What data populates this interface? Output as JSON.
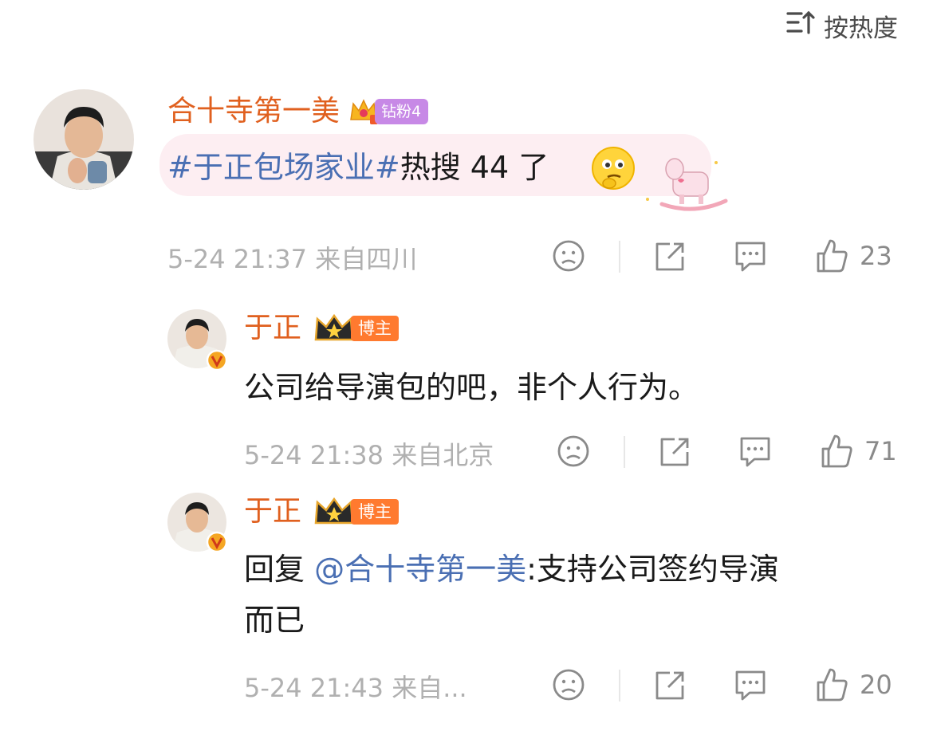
{
  "sort": {
    "label": "按热度"
  },
  "comment": {
    "user": "合十寺第一美",
    "fan_badge": "钻粉4",
    "topic": "#于正包场家业#",
    "text_tail": "热搜 44 了",
    "meta": "5-24 21:37 来自四川",
    "likes": "23"
  },
  "replies": [
    {
      "user": "于正",
      "badge": "博主",
      "text": "公司给导演包的吧，非个人行为。",
      "meta": "5-24 21:38 来自北京",
      "likes": "71"
    },
    {
      "user": "于正",
      "badge": "博主",
      "reply_prefix": "回复",
      "mention": "@合十寺第一美",
      "text_line1": ":支持公司签约导演",
      "text_line2": "而已",
      "meta": "5-24 21:43 来自...",
      "likes": "20"
    }
  ],
  "colors": {
    "name": "#e0601f",
    "topic": "#4a6fb3",
    "meta": "#b0b0b0"
  }
}
